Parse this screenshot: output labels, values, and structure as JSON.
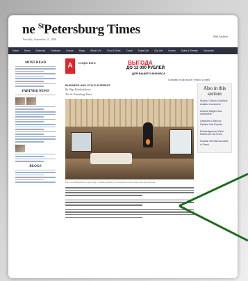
{
  "masthead": {
    "logo_prefix": "ne",
    "logo_sup": "St",
    "logo_main": "Petersburg Times",
    "dateline": "Thursday, September 11, 2008",
    "topright": "RSS  Archive"
  },
  "nav": [
    "Home",
    "News",
    "Business",
    "Features",
    "Culture",
    "Blogs",
    "What's On",
    "Food & Drink",
    "Travel",
    "Expat Life",
    "City Life",
    "Events",
    "Sales & Rentals",
    "Subscribe"
  ],
  "left": {
    "most_read": "MOST READ",
    "partner_news": "PARTNER NEWS",
    "blogs": "BLOGS"
  },
  "ad": {
    "bank": "Альфа-Банк",
    "promo_line1": "ВЫГОДА",
    "promo_line2": "ДО 12 000 РУБЛЕЙ",
    "promo_line3": "ДЛЯ ВАШЕГО БИЗНЕСА"
  },
  "article": {
    "kicker": "BUSINESS AND STYLE INTEREST",
    "byline1": "By Olga Kolokolnikova",
    "byline2": "The St. Petersburg Times",
    "caption": "Pilot accommodation is growing to feature modern wood interiors and cosier open plan layouts."
  },
  "sidebar": {
    "also_title": "Also in this section",
    "items": [
      "Russia, China to Continue Aviation Investment",
      "Ukraine Weighs Gas Investment",
      "Gazprom to Step up Pipeline Gas Exports",
      "Russia Approves Real Estate and Tax Fixes",
      "Russian Oil Giant Accused of Fraud"
    ]
  },
  "links_row": "Comment on this article  |  Send to a friend",
  "colors": {
    "accent_red": "#e0252b",
    "arrow_green": "#1f6b1f",
    "nav_bg": "#2d3140"
  }
}
